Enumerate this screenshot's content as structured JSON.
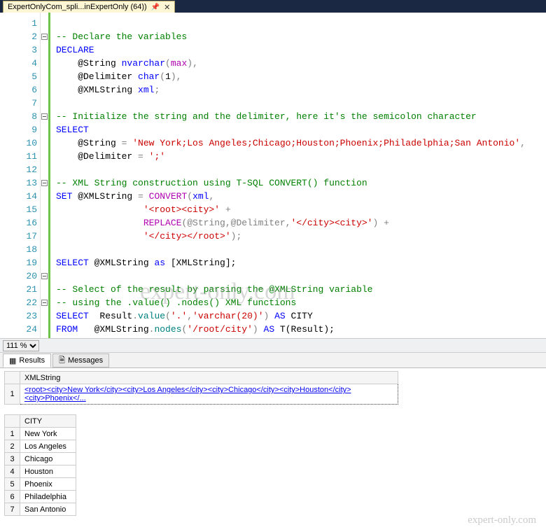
{
  "tab": {
    "title": "ExpertOnlyCom_spli...inExpertOnly (64))"
  },
  "zoom": {
    "value": "111 %"
  },
  "line_numbers": [
    "1",
    "2",
    "3",
    "4",
    "5",
    "6",
    "7",
    "8",
    "9",
    "10",
    "11",
    "12",
    "13",
    "14",
    "15",
    "16",
    "17",
    "18",
    "19",
    "20",
    "21",
    "22",
    "23",
    "24"
  ],
  "fold_rows": [
    2,
    8,
    13,
    20,
    22
  ],
  "code": {
    "l1": "-- Declare the variables",
    "l2": "DECLARE",
    "l3_a": "    @String ",
    "l3_b": "nvarchar",
    "l3_c": "(",
    "l3_d": "max",
    "l3_e": "),",
    "l4_a": "    @Delimiter ",
    "l4_b": "char",
    "l4_c": "(",
    "l4_d": "1",
    "l4_e": "),",
    "l5_a": "    @XMLString ",
    "l5_b": "xml",
    "l5_c": ";",
    "l7": "-- Initialize the string and the delimiter, here it's the semicolon character",
    "l8": "SELECT",
    "l9_a": "    @String ",
    "l9_b": "=",
    "l9_c": " 'New York;Los Angeles;Chicago;Houston;Phoenix;Philadelphia;San Antonio'",
    "l9_d": ",",
    "l10_a": "    @Delimiter ",
    "l10_b": "=",
    "l10_c": " ';'",
    "l12": "-- XML String construction using T-SQL CONVERT() function",
    "l13_a": "SET",
    "l13_b": " @XMLString ",
    "l13_c": "=",
    "l13_d": " CONVERT",
    "l13_e": "(",
    "l13_f": "xml",
    "l13_g": ",",
    "l14_a": "                '<root><city>'",
    "l14_b": " +",
    "l15_a": "                ",
    "l15_b": "REPLACE",
    "l15_c": "(@String,@Delimiter,",
    "l15_d": "'</city><city>'",
    "l15_e": ")",
    "l15_f": " +",
    "l16_a": "                ",
    "l16_b": "'</city></root>'",
    "l16_c": ");",
    "l18_a": "SELECT",
    "l18_b": " @XMLString ",
    "l18_c": "as",
    "l18_d": " [XMLString];",
    "l20": "-- Select of the result by parsing the @XMLString variable",
    "l21": "-- using the .value() .nodes() XML functions",
    "l22_a": "SELECT",
    "l22_b": "  Result",
    "l22_c": ".",
    "l22_d": "value",
    "l22_e": "(",
    "l22_f": "'.'",
    "l22_g": ",",
    "l22_h": "'varchar(20)'",
    "l22_i": ")",
    "l22_j": " AS",
    "l22_k": " CITY",
    "l23_a": "FROM",
    "l23_b": "   @XMLString",
    "l23_c": ".",
    "l23_d": "nodes",
    "l23_e": "(",
    "l23_f": "'/root/city'",
    "l23_g": ")",
    "l23_h": " AS",
    "l23_i": " T(Result);"
  },
  "results_tabs": {
    "results": "Results",
    "messages": "Messages"
  },
  "grid1": {
    "header": "XMLString",
    "row1_num": "1",
    "row1_val": "<root><city>New York</city><city>Los Angeles</city><city>Chicago</city><city>Houston</city><city>Phoenix</..."
  },
  "grid2": {
    "header": "CITY",
    "rows": [
      {
        "n": "1",
        "v": "New York"
      },
      {
        "n": "2",
        "v": "Los Angeles"
      },
      {
        "n": "3",
        "v": "Chicago"
      },
      {
        "n": "4",
        "v": "Houston"
      },
      {
        "n": "5",
        "v": "Phoenix"
      },
      {
        "n": "6",
        "v": "Philadelphia"
      },
      {
        "n": "7",
        "v": "San Antonio"
      }
    ]
  },
  "watermark": "expert-only.com",
  "watermark2": "expert-only.com"
}
